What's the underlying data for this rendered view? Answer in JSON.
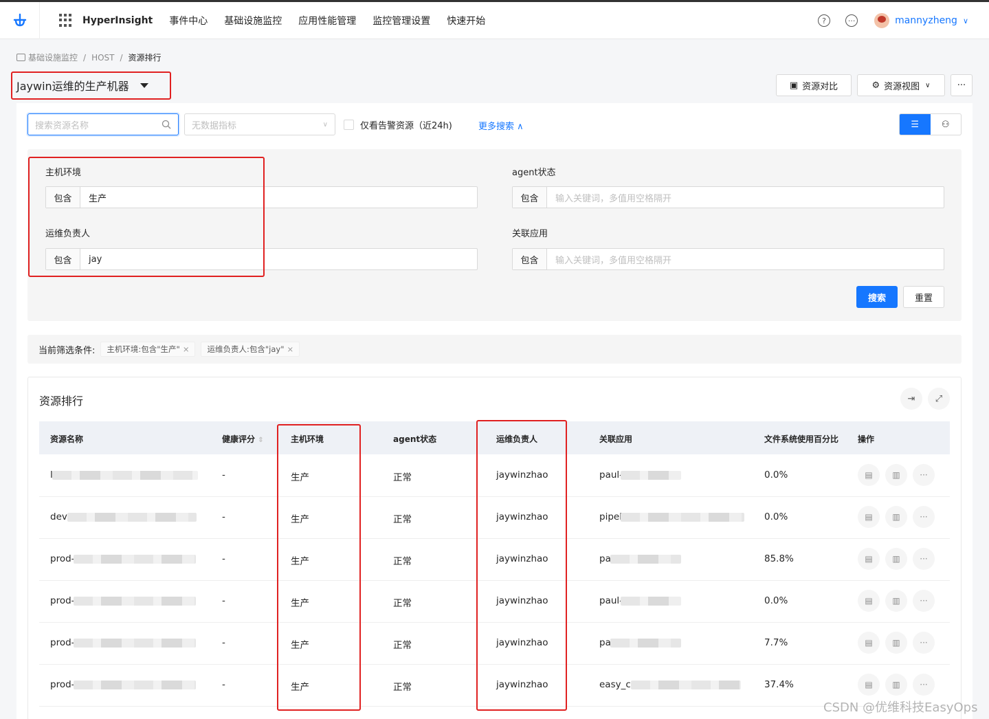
{
  "topbar": {
    "brand": "HyperInsight",
    "nav": [
      "事件中心",
      "基础设施监控",
      "应用性能管理",
      "监控管理设置",
      "快速开始"
    ],
    "help_icon": "question-circle-icon",
    "message_icon": "message-icon",
    "username": "mannyzheng"
  },
  "breadcrumb": [
    "基础设施监控",
    "HOST",
    "资源排行"
  ],
  "page_title": "Jaywin运维的生产机器",
  "header_buttons": {
    "compare": "资源对比",
    "view": "资源视图",
    "more": "···"
  },
  "search": {
    "placeholder": "搜索资源名称",
    "metric_placeholder": "无数据指标",
    "alert_only_label": "仅看告警资源（近24h)",
    "more_search": "更多搜索"
  },
  "filters": [
    {
      "label": "主机环境",
      "op": "包含",
      "value": "生产",
      "placeholder": ""
    },
    {
      "label": "agent状态",
      "op": "包含",
      "value": "",
      "placeholder": "输入关键词，多值用空格隔开"
    },
    {
      "label": "运维负责人",
      "op": "包含",
      "value": "jay",
      "placeholder": ""
    },
    {
      "label": "关联应用",
      "op": "包含",
      "value": "",
      "placeholder": "输入关键词，多值用空格隔开"
    }
  ],
  "actions": {
    "search": "搜索",
    "reset": "重置"
  },
  "conditions": {
    "label": "当前筛选条件:",
    "tags": [
      "主机环境:包含\"生产\"",
      "运维负责人:包含\"jay\""
    ]
  },
  "table": {
    "title": "资源排行",
    "columns": [
      "资源名称",
      "健康评分",
      "主机环境",
      "agent状态",
      "运维负责人",
      "关联应用",
      "文件系统使用百分比",
      "操作"
    ],
    "rows": [
      {
        "name": "l",
        "health": "-",
        "env": "生产",
        "agent": "正常",
        "owner": "jaywinzhao",
        "app": "paul-",
        "fs": "0.0%"
      },
      {
        "name": "dev",
        "health": "-",
        "env": "生产",
        "agent": "正常",
        "owner": "jaywinzhao",
        "app": "pipel",
        "fs": "0.0%"
      },
      {
        "name": "prod-",
        "health": "-",
        "env": "生产",
        "agent": "正常",
        "owner": "jaywinzhao",
        "app": "pa",
        "fs": "85.8%"
      },
      {
        "name": "prod-",
        "health": "-",
        "env": "生产",
        "agent": "正常",
        "owner": "jaywinzhao",
        "app": "paul-",
        "fs": "0.0%"
      },
      {
        "name": "prod-",
        "health": "-",
        "env": "生产",
        "agent": "正常",
        "owner": "jaywinzhao",
        "app": "pa",
        "fs": "7.7%"
      },
      {
        "name": "prod-",
        "health": "-",
        "env": "生产",
        "agent": "正常",
        "owner": "jaywinzhao",
        "app": "easy_c",
        "fs": "37.4%"
      }
    ]
  },
  "watermark": "CSDN @优维科技EasyOps",
  "colors": {
    "accent": "#1677ff",
    "highlight": "#e02020"
  }
}
